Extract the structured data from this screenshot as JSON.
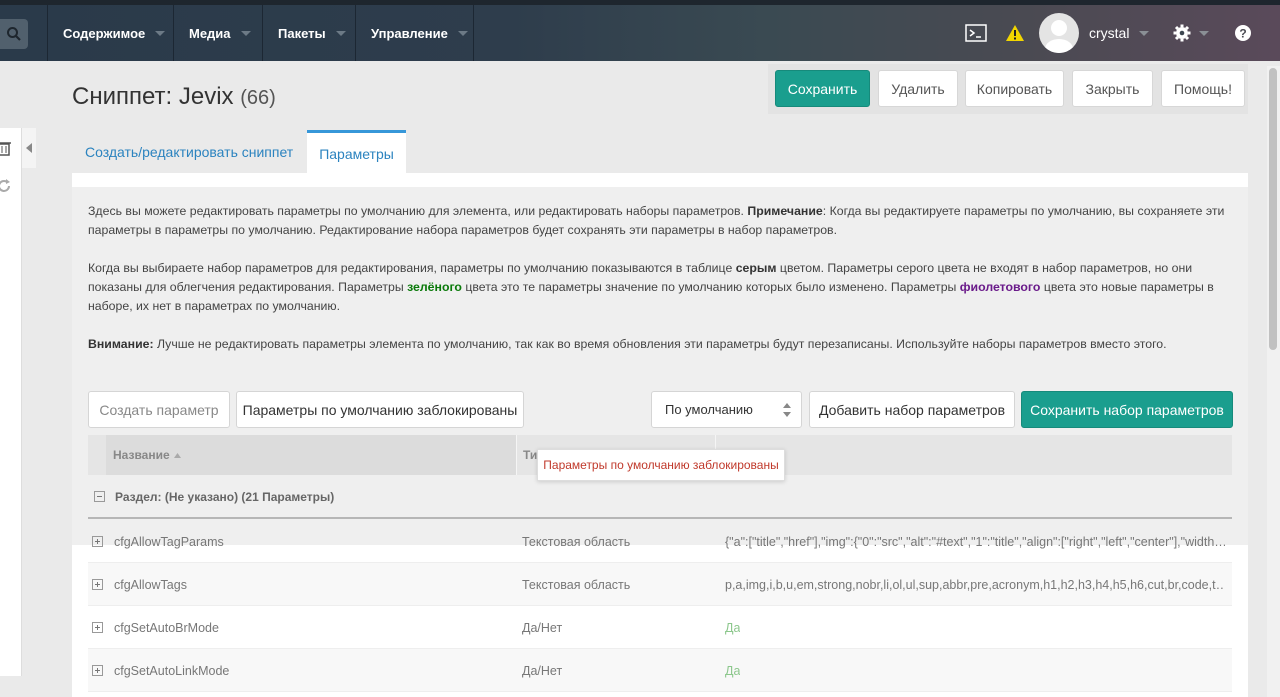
{
  "topbar": {
    "nav": [
      {
        "label": "Содержимое"
      },
      {
        "label": "Медиа"
      },
      {
        "label": "Пакеты"
      },
      {
        "label": "Управление"
      }
    ],
    "username": "crystal"
  },
  "page": {
    "title": "Сниппет: Jevix",
    "id": "(66)"
  },
  "actions": {
    "save": "Сохранить",
    "delete": "Удалить",
    "copy": "Копировать",
    "close": "Закрыть",
    "help": "Помощь!"
  },
  "tabs": {
    "edit": "Создать/редактировать сниппет",
    "params": "Параметры"
  },
  "info": {
    "p1_a": "Здесь вы можете редактировать параметры по умолчанию для элемента, или редактировать наборы параметров. ",
    "p1_b": "Примечание",
    "p1_c": ": Когда вы редактируете параметры по умолчанию, вы сохраняете эти параметры в параметры по умолчанию. Редактирование набора параметров будет сохранять эти параметры в набор параметров.",
    "p2_a": "Когда вы выбираете набор параметров для редактирования, параметры по умолчанию показываются в таблице ",
    "p2_b": "серым",
    "p2_c": " цветом. Параметры серого цвета не входят в набор параметров, но они показаны для облегчения редактирования. Параметры ",
    "p2_d": "зелёного",
    "p2_e": " цвета это те параметры значение по умолчанию которых было изменено. Параметры ",
    "p2_f": "фиолетового",
    "p2_g": " цвета это новые параметры в наборе, их нет в параметрах по умолчанию.",
    "p3_a": "Внимание:",
    "p3_b": " Лучше не редактировать параметры элемента по умолчанию, так как во время обновления эти параметры будут перезаписаны. Используйте наборы параметров вместо этого."
  },
  "toolbar": {
    "create_param": "Создать параметр",
    "defaults_locked": "Параметры по умолчанию заблокированы",
    "set_select": "По умолчанию",
    "add_set": "Добавить набор параметров",
    "save_set": "Сохранить набор параметров"
  },
  "grid": {
    "col_name": "Название",
    "col_type": "Ти",
    "group": "Раздел: (Не указано) (21 Параметры)",
    "rows": [
      {
        "name": "cfgAllowTagParams",
        "type": "Текстовая область",
        "value": "{\"a\":[\"title\",\"href\"],\"img\":{\"0\":\"src\",\"alt\":\"#text\",\"1\":\"title\",\"align\":[\"right\",\"left\",\"center\"],\"width…"
      },
      {
        "name": "cfgAllowTags",
        "type": "Текстовая область",
        "value": "p,a,img,i,b,u,em,strong,nobr,li,ol,ul,sup,abbr,pre,acronym,h1,h2,h3,h4,h5,h6,cut,br,code,t…"
      },
      {
        "name": "cfgSetAutoBrMode",
        "type": "Да/Нет",
        "value": "Да"
      },
      {
        "name": "cfgSetAutoLinkMode",
        "type": "Да/Нет",
        "value": "Да"
      }
    ]
  },
  "tooltip": "Параметры по умолчанию заблокированы",
  "colors": {
    "primary": "#1a9e8e",
    "link": "#2b83bf",
    "tooltip_text": "#c0392b",
    "yes_value": "#8cc78c"
  }
}
